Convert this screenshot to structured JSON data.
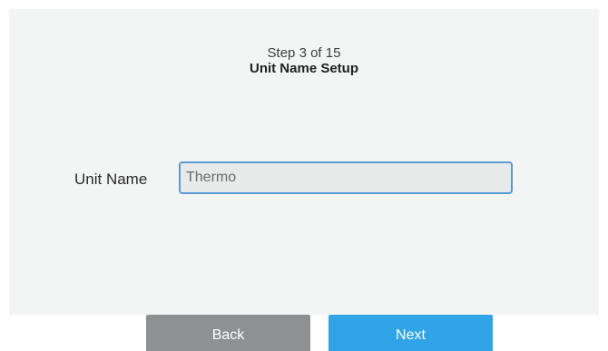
{
  "header": {
    "step_counter": "Step 3 of 15",
    "title": "Unit Name Setup"
  },
  "form": {
    "unit_name_label": "Unit Name",
    "unit_name_value": "Thermo"
  },
  "footer": {
    "back_label": "Back",
    "next_label": "Next"
  },
  "colors": {
    "panel_background": "#f3f5f5",
    "input_border": "#5b9bd5",
    "back_button": "#8e9091",
    "next_button": "#2fa4e7"
  }
}
